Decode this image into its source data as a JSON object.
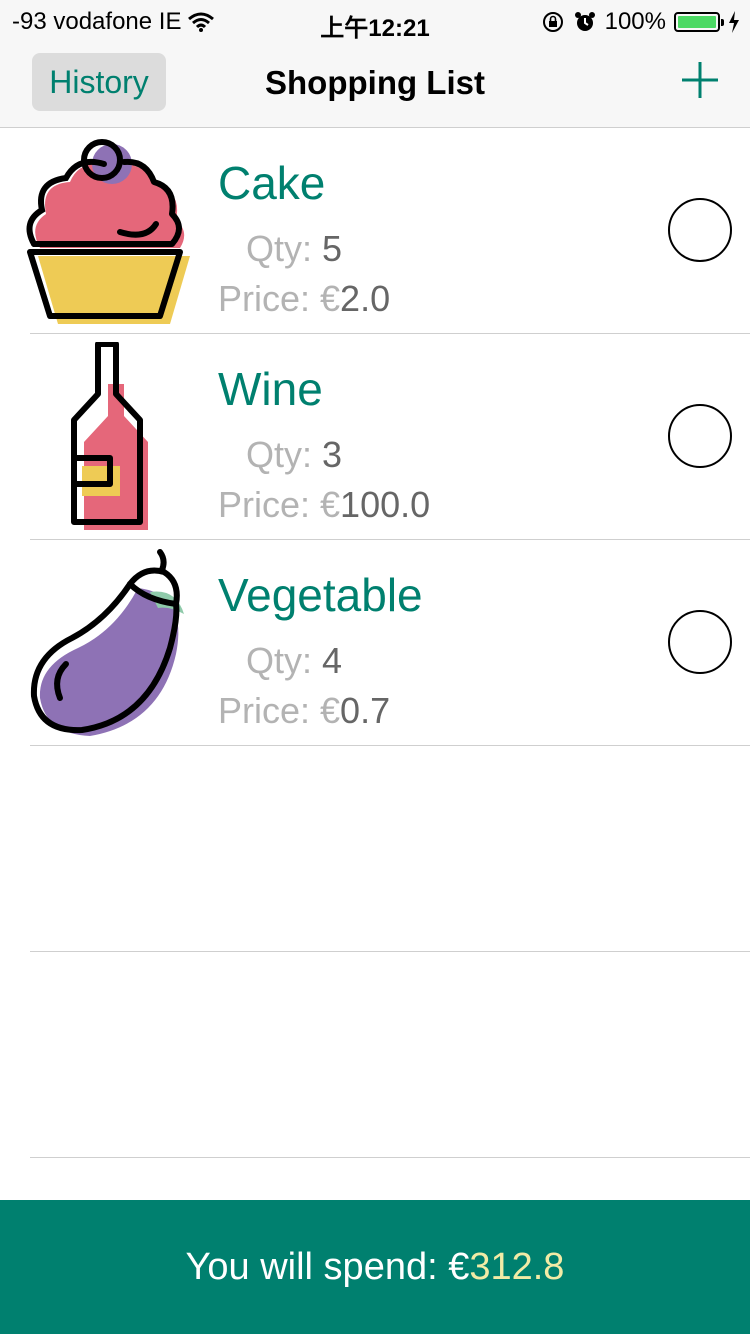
{
  "status_bar": {
    "carrier": "-93 vodafone IE",
    "time": "上午12:21",
    "battery_percent": "100%",
    "icons": [
      "wifi-icon",
      "orientation-lock-icon",
      "alarm-icon",
      "battery-icon",
      "charging-bolt-icon"
    ]
  },
  "nav": {
    "history_label": "History",
    "title": "Shopping List",
    "add_icon": "plus-icon"
  },
  "colors": {
    "accent": "#00806f",
    "total_highlight": "#f2eba6",
    "cake_frosting": "#e5677a",
    "cake_base": "#eecb55",
    "eggplant": "#8e72b5",
    "leaf": "#8fcaaa"
  },
  "items": [
    {
      "name": "Cake",
      "qty_label": "Qty:",
      "qty": "5",
      "price_label": "Price: €",
      "price": "2.0",
      "icon": "cupcake-icon"
    },
    {
      "name": "Wine",
      "qty_label": "Qty:",
      "qty": "3",
      "price_label": "Price: €",
      "price": "100.0",
      "icon": "wine-bottle-icon"
    },
    {
      "name": "Vegetable",
      "qty_label": "Qty:",
      "qty": "4",
      "price_label": "Price: €",
      "price": "0.7",
      "icon": "eggplant-icon"
    }
  ],
  "footer": {
    "label": "You will spend: €",
    "total": "312.8"
  }
}
